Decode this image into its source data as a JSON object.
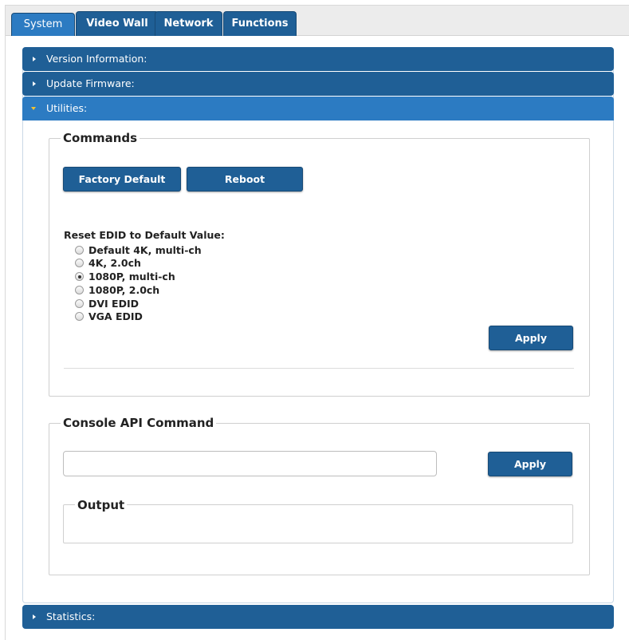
{
  "tabs": [
    {
      "label": "System",
      "active": true
    },
    {
      "label": "Video Wall",
      "active": false
    },
    {
      "label": "Network",
      "active": false
    },
    {
      "label": "Functions",
      "active": false
    }
  ],
  "accordion": {
    "version_info": "Version Information:",
    "update_firmware": "Update Firmware:",
    "utilities": "Utilities:",
    "statistics": "Statistics:"
  },
  "commands": {
    "legend": "Commands",
    "factory_default": "Factory Default",
    "reboot": "Reboot",
    "edid_label": "Reset EDID to Default Value:",
    "edid_options": [
      {
        "label": "Default 4K, multi-ch",
        "checked": false
      },
      {
        "label": "4K, 2.0ch",
        "checked": false
      },
      {
        "label": "1080P, multi-ch",
        "checked": true
      },
      {
        "label": "1080P, 2.0ch",
        "checked": false
      },
      {
        "label": "DVI EDID",
        "checked": false
      },
      {
        "label": "VGA EDID",
        "checked": false
      }
    ],
    "apply": "Apply"
  },
  "console": {
    "legend": "Console API Command",
    "input_value": "",
    "apply": "Apply",
    "output_legend": "Output",
    "output_text": ""
  },
  "colors": {
    "tab_bg": "#1f5f96",
    "tab_active_bg": "#2c7bc2",
    "header_bg": "#1f5f96",
    "header_open_bg": "#2c7bc2",
    "button_bg": "#1f5f96",
    "caret_open": "#f2c230"
  }
}
